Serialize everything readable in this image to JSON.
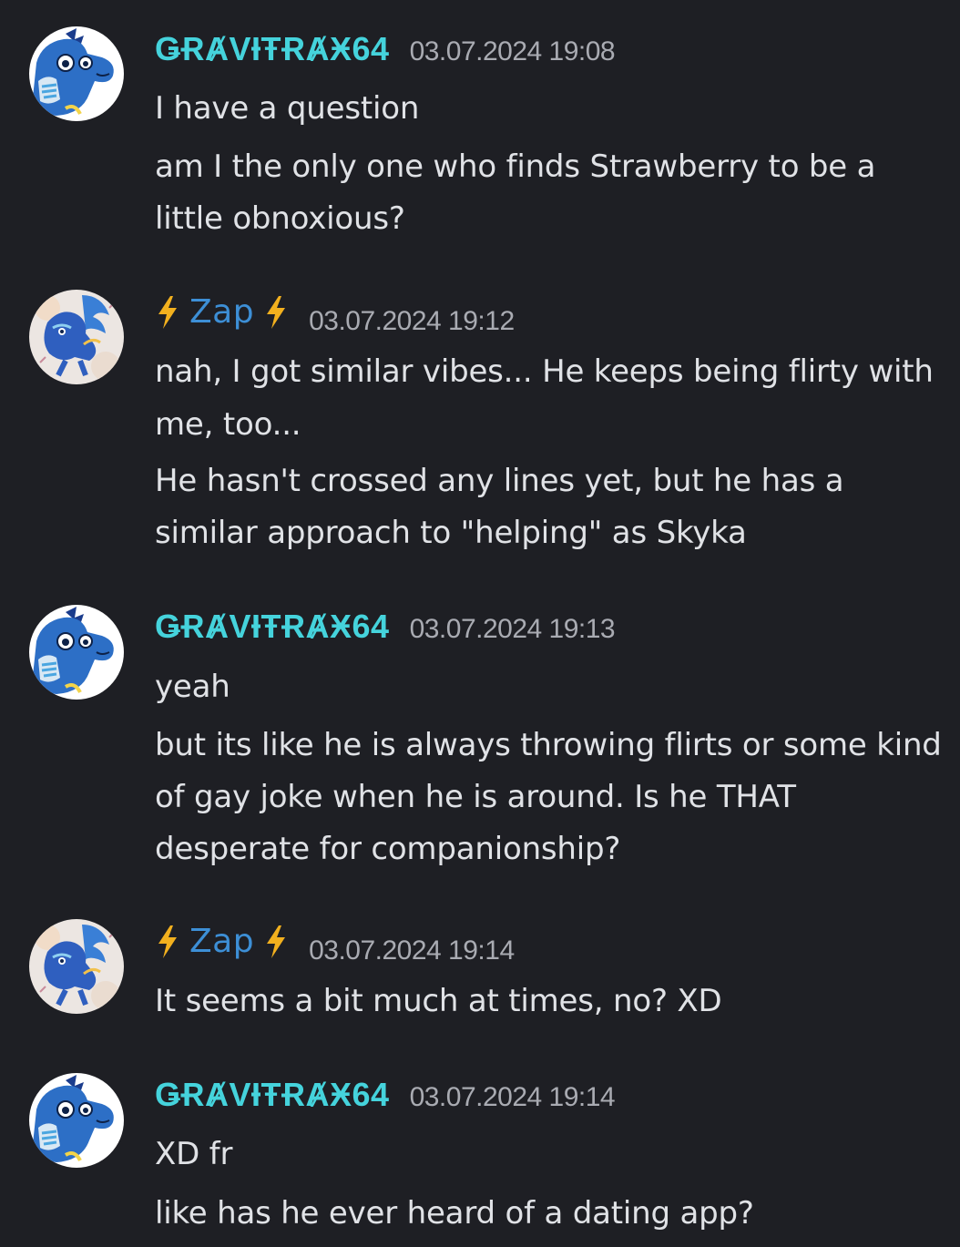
{
  "messages": [
    {
      "author": "ǤɌȺVƗŦɌȺӾ64",
      "timestamp": "03.07.2024 19:08",
      "avatar_icon": "blue-dragon-avatar-icon",
      "lines": [
        "I have a question",
        "am I the only one who finds Strawberry to be a",
        "little obnoxious?"
      ]
    },
    {
      "author": "Zap",
      "timestamp": "03.07.2024 19:12",
      "avatar_icon": "zap-dragon-avatar-icon",
      "lines": [
        "nah, I got similar vibes... He keeps being flirty with",
        "me, too...",
        "He hasn't crossed any lines yet, but he has a",
        "similar approach to \"helping\" as Skyka"
      ]
    },
    {
      "author": "ǤɌȺVƗŦɌȺӾ64",
      "timestamp": "03.07.2024 19:13",
      "avatar_icon": "blue-dragon-avatar-icon",
      "lines": [
        "yeah",
        "but its like he is always throwing flirts or some kind",
        "of gay joke when he is around. Is he THAT",
        "desperate for companionship?"
      ]
    },
    {
      "author": "Zap",
      "timestamp": "03.07.2024 19:14",
      "avatar_icon": "zap-dragon-avatar-icon",
      "lines": [
        "It seems a bit much at times, no? XD"
      ]
    },
    {
      "author": "ǤɌȺVƗŦɌȺӾ64",
      "timestamp": "03.07.2024 19:14",
      "avatar_icon": "blue-dragon-avatar-icon",
      "lines": [
        "XD fr",
        "like has he ever heard of a dating app?"
      ]
    }
  ],
  "colors": {
    "background": "#1e1f24",
    "gravitrax_name": "#45d3dc",
    "zap_name": "#3d8fd6",
    "bolt": "#f2b01e",
    "timestamp": "#a9abb2",
    "message_text": "#e0e2e6"
  }
}
